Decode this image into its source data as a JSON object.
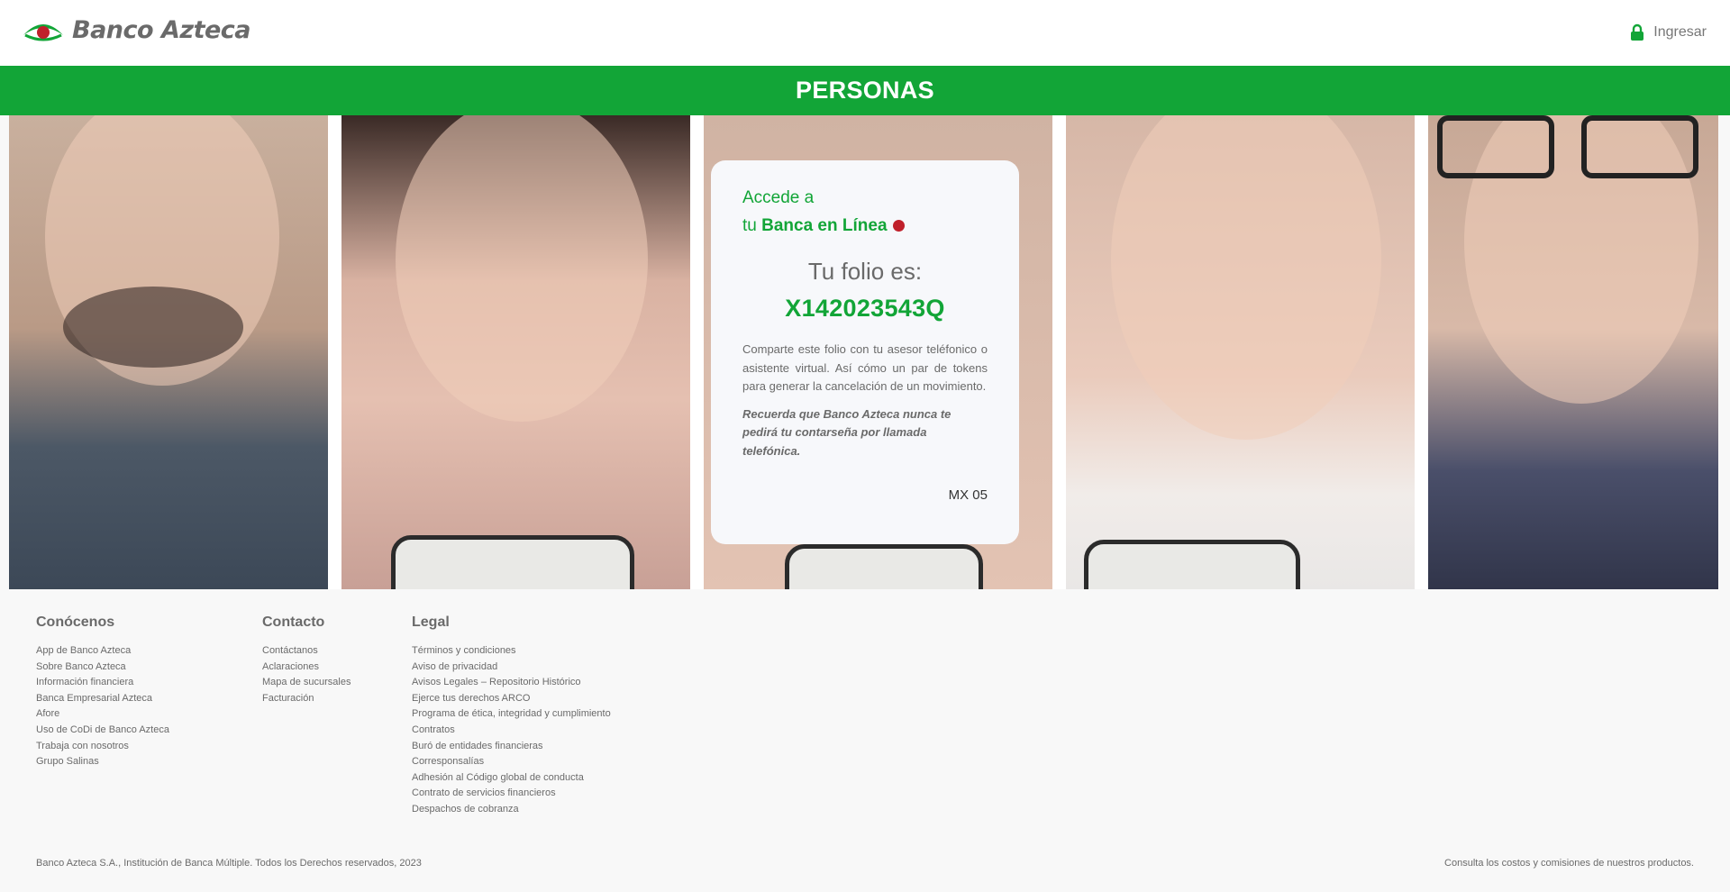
{
  "header": {
    "brand": "Banco Azteca",
    "login_label": "Ingresar"
  },
  "banner": {
    "title": "PERSONAS"
  },
  "card": {
    "line1": "Accede a",
    "line2_prefix": "tu ",
    "line2_strong": "Banca en Línea",
    "folio_label": "Tu folio es:",
    "folio_value": "X142023543Q",
    "body": "Comparte este folio con tu asesor teléfonico o asistente virtual. Así cómo un par de tokens para generar la cancelación de un movimiento.",
    "note": "Recuerda que Banco Azteca nunca te pedirá tu contarseña por llamada telefónica.",
    "code": "MX 05"
  },
  "footer": {
    "columns": [
      {
        "title": "Conócenos",
        "links": [
          "App de Banco Azteca",
          "Sobre Banco Azteca",
          "Información financiera",
          "Banca Empresarial Azteca",
          "Afore",
          "Uso de CoDi de Banco Azteca",
          "Trabaja con nosotros",
          "Grupo Salinas"
        ]
      },
      {
        "title": "Contacto",
        "links": [
          "Contáctanos",
          "Aclaraciones",
          "Mapa de sucursales",
          "Facturación"
        ]
      },
      {
        "title": "Legal",
        "links": [
          "Términos y condiciones",
          "Aviso de privacidad",
          "Avisos Legales – Repositorio Histórico",
          "Ejerce tus derechos ARCO",
          "Programa de ética, integridad y cumplimiento",
          "Contratos",
          "Buró de entidades financieras",
          "Corresponsalías",
          "Adhesión al Código global de conducta",
          "Contrato de servicios financieros",
          "Despachos de cobranza"
        ]
      }
    ],
    "copyright": "Banco Azteca S.A., Institución de Banca Múltiple. Todos los Derechos reservados, 2023",
    "costs_link": "Consulta los costos y comisiones de nuestros productos."
  },
  "colors": {
    "brand_green": "#12a537",
    "brand_red": "#c0202b",
    "text_gray": "#6a6a6a"
  },
  "icons": {
    "logo": "banco-azteca-eye-logo",
    "login": "lock-icon",
    "status_dot": "red-dot-icon"
  }
}
